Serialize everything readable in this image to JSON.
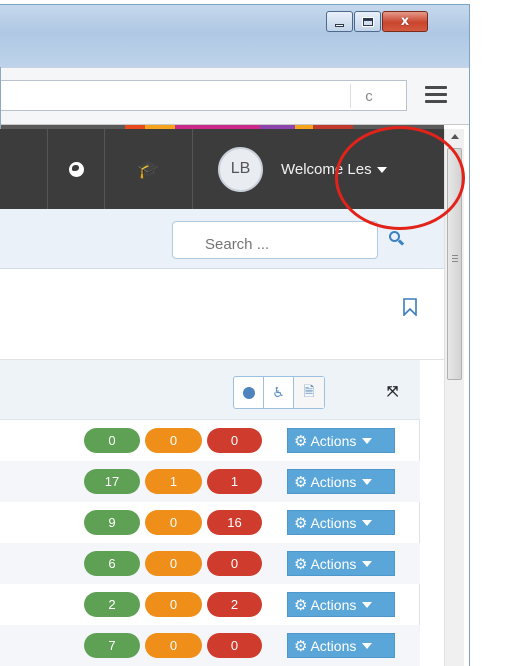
{
  "window": {
    "close_glyph": "x",
    "minimize_glyph": "",
    "maximize_glyph": ""
  },
  "browser": {
    "reload_glyph": "c",
    "menu_icon": "hamburger-icon"
  },
  "stripe_colors": [
    "#e8491d",
    "#f4a41c",
    "#8e44ad",
    "#c0392b",
    "#e91e63",
    "#9c27b0",
    "#ff9800",
    "#e53935"
  ],
  "nav": {
    "globe_icon": "globe-icon",
    "cap_icon": "graduation-cap-icon",
    "cap_glyph": "🎓",
    "avatar_initials": "LB",
    "welcome_text": "Welcome Les"
  },
  "search": {
    "placeholder": "Search ..."
  },
  "panel": {
    "buttons": [
      "globe-icon",
      "accessibility-icon",
      "document-icon"
    ],
    "accessibility_glyph": "♿",
    "document_glyph": "🗎",
    "expand_glyph": "⤧",
    "rows": [
      {
        "green": "0",
        "orange": "0",
        "red": "0",
        "action": "Actions"
      },
      {
        "green": "17",
        "orange": "1",
        "red": "1",
        "action": "Actions"
      },
      {
        "green": "9",
        "orange": "0",
        "red": "16",
        "action": "Actions"
      },
      {
        "green": "6",
        "orange": "0",
        "red": "0",
        "action": "Actions"
      },
      {
        "green": "2",
        "orange": "0",
        "red": "2",
        "action": "Actions"
      },
      {
        "green": "7",
        "orange": "0",
        "red": "0",
        "action": "Actions"
      }
    ]
  },
  "colors": {
    "nav_bg": "#3c3c3c",
    "green": "#5fa154",
    "orange": "#f08e1a",
    "red": "#cf3c2e",
    "action_blue": "#5aa6d9",
    "highlight_circle": "#e2231a"
  }
}
